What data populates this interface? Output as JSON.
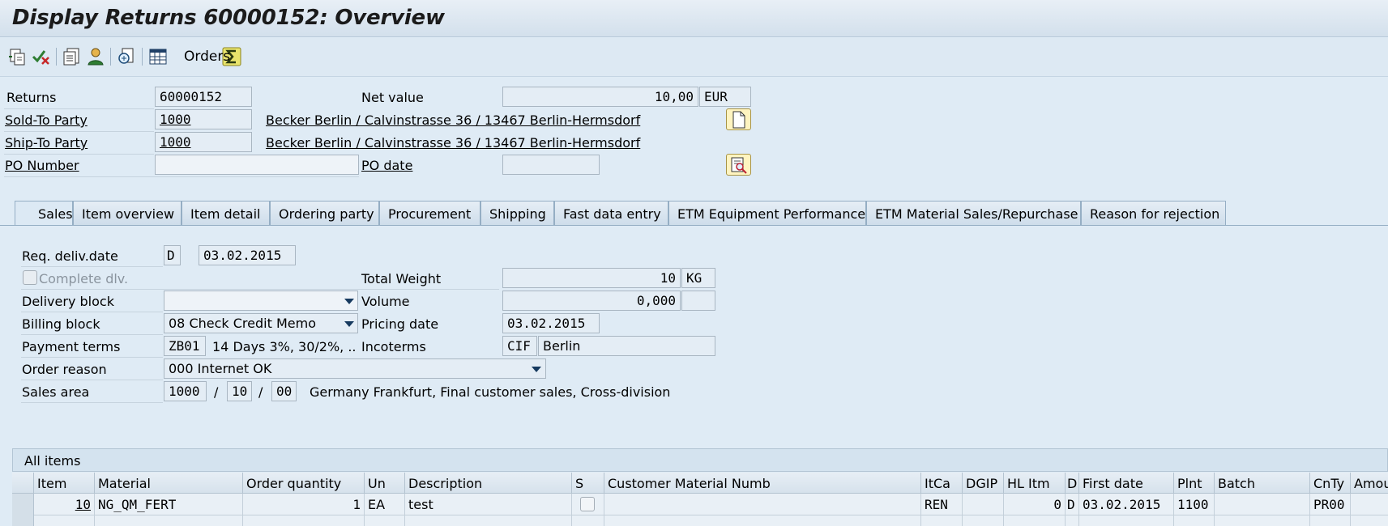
{
  "window": {
    "title": "Display Returns 60000152: Overview"
  },
  "toolbar": {
    "icons": [
      "document-flow-icon",
      "check-status-icon",
      "header-details-icon",
      "business-partner-icon",
      "display-document-icon",
      "orders-grid-icon",
      "sum-icon"
    ],
    "orders_label": "Orders"
  },
  "header": {
    "returns_label": "Returns",
    "returns_value": "60000152",
    "net_value_label": "Net value",
    "net_value": "10,00",
    "currency": "EUR",
    "sold_to_label": "Sold-To Party",
    "sold_to_value": "1000",
    "sold_to_address": "Becker Berlin / Calvinstrasse 36 / 13467 Berlin-Hermsdorf",
    "ship_to_label": "Ship-To Party",
    "ship_to_value": "1000",
    "ship_to_address": "Becker Berlin / Calvinstrasse 36 / 13467 Berlin-Hermsdorf",
    "po_number_label": "PO Number",
    "po_number_value": "",
    "po_date_label": "PO date",
    "po_date_value": ""
  },
  "tabs": [
    {
      "label": "Sales",
      "active": true
    },
    {
      "label": "Item overview"
    },
    {
      "label": "Item detail"
    },
    {
      "label": "Ordering party"
    },
    {
      "label": "Procurement"
    },
    {
      "label": "Shipping"
    },
    {
      "label": "Fast data entry"
    },
    {
      "label": "ETM Equipment Performance"
    },
    {
      "label": "ETM Material Sales/Repurchase"
    },
    {
      "label": "Reason for rejection"
    }
  ],
  "sales": {
    "req_deliv_label": "Req. deliv.date",
    "req_deliv_type": "D",
    "req_deliv_date": "03.02.2015",
    "complete_dlv_label": "Complete dlv.",
    "total_weight_label": "Total Weight",
    "total_weight_value": "10",
    "total_weight_unit": "KG",
    "delivery_block_label": "Delivery block",
    "delivery_block_value": "",
    "volume_label": "Volume",
    "volume_value": "0,000",
    "volume_unit": "",
    "billing_block_label": "Billing block",
    "billing_block_value": "08 Check Credit Memo",
    "pricing_date_label": "Pricing date",
    "pricing_date_value": "03.02.2015",
    "payment_terms_label": "Payment terms",
    "payment_terms_code": "ZB01",
    "payment_terms_text": "14 Days 3%, 30/2%, ...",
    "incoterms_label": "Incoterms",
    "incoterms_code": "CIF",
    "incoterms_place": "Berlin",
    "order_reason_label": "Order reason",
    "order_reason_value": "000 Internet OK",
    "sales_area_label": "Sales area",
    "sales_org": "1000",
    "dist_channel": "10",
    "division": "00",
    "sep": "/",
    "sales_area_text": "Germany Frankfurt, Final customer sales, Cross-division"
  },
  "items": {
    "title": "All items",
    "columns": [
      "Item",
      "Material",
      "Order quantity",
      "Un",
      "Description",
      "S",
      "Customer Material Numb",
      "ItCa",
      "DGIP",
      "HL Itm",
      "D",
      "First date",
      "Plnt",
      "Batch",
      "CnTy",
      "Amou"
    ],
    "rows": [
      {
        "item": "10",
        "material": "NG_QM_FERT",
        "quantity": "1",
        "unit": "EA",
        "description": "test",
        "s": "",
        "cust_mat": "",
        "itca": "REN",
        "dgip": "",
        "hl_itm": "0",
        "d": "D",
        "first_date": "03.02.2015",
        "plnt": "1100",
        "batch": "",
        "cnty": "PR00",
        "amount": ""
      }
    ]
  }
}
